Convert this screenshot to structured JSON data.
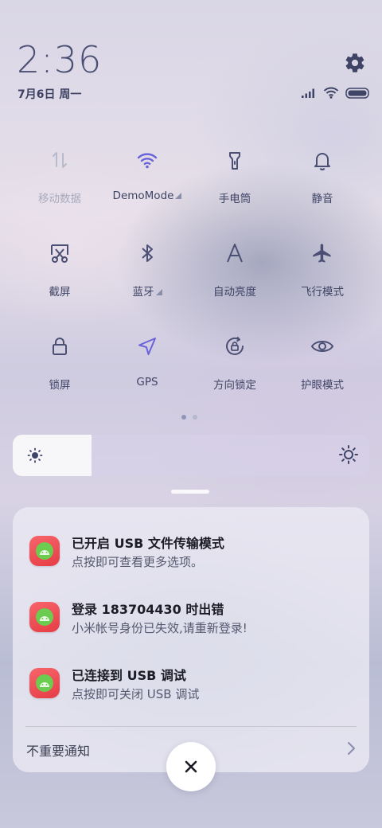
{
  "status": {
    "time": "2:36",
    "date": "7月6日 周一",
    "icons": [
      "signal-icon",
      "wifi-icon",
      "battery-icon"
    ]
  },
  "quick_settings": [
    {
      "label": "移动数据",
      "icon": "mobile-data-icon",
      "active": false
    },
    {
      "label": "DemoMode",
      "icon": "wifi-icon",
      "active": true,
      "expandable": true
    },
    {
      "label": "手电筒",
      "icon": "flashlight-icon",
      "active": false
    },
    {
      "label": "静音",
      "icon": "bell-icon",
      "active": false
    },
    {
      "label": "截屏",
      "icon": "screenshot-icon",
      "active": false
    },
    {
      "label": "蓝牙",
      "icon": "bluetooth-icon",
      "active": false,
      "expandable": true
    },
    {
      "label": "自动亮度",
      "icon": "auto-brightness-icon",
      "active": false
    },
    {
      "label": "飞行模式",
      "icon": "airplane-icon",
      "active": false
    },
    {
      "label": "锁屏",
      "icon": "lock-icon",
      "active": false
    },
    {
      "label": "GPS",
      "icon": "location-icon",
      "active": true
    },
    {
      "label": "方向锁定",
      "icon": "rotation-lock-icon",
      "active": false
    },
    {
      "label": "护眼模式",
      "icon": "eye-icon",
      "active": false
    }
  ],
  "pager": {
    "pages": 2,
    "current": 1
  },
  "brightness": {
    "level": 0.22
  },
  "notifications": [
    {
      "title": "已开启 USB 文件传输模式",
      "body": "点按即可查看更多选项。"
    },
    {
      "title": "登录 183704430 时出错",
      "body": "小米帐号身份已失效,请重新登录!"
    },
    {
      "title": "已连接到 USB 调试",
      "body": "点按即可关闭 USB 调试"
    }
  ],
  "unimportant_label": "不重要通知",
  "colors": {
    "accent": "#6b63d8",
    "icon": "#4a4f73",
    "dim": "#a9abbd",
    "app_red": "#ee4b52",
    "app_green": "#6ccc4f"
  }
}
